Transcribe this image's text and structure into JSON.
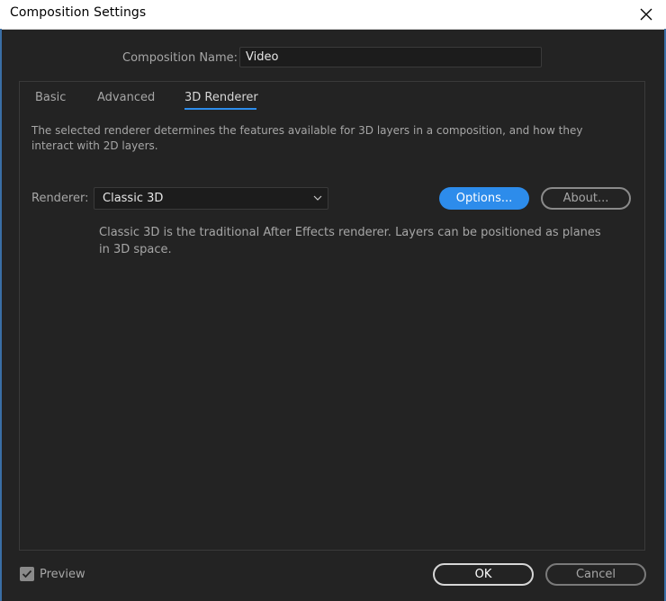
{
  "window": {
    "title": "Composition Settings",
    "close_icon": "close-icon"
  },
  "composition": {
    "name_label": "Composition Name:",
    "name_value": "Video"
  },
  "tabs": [
    {
      "label": "Basic",
      "active": false
    },
    {
      "label": "Advanced",
      "active": false
    },
    {
      "label": "3D Renderer",
      "active": true
    }
  ],
  "renderer_tab": {
    "description": "The selected renderer determines the features available for 3D layers in a composition, and how they interact with 2D layers.",
    "renderer_label": "Renderer:",
    "renderer_value": "Classic 3D",
    "options_button": "Options...",
    "about_button": "About...",
    "renderer_description": "Classic 3D is the traditional After Effects renderer. Layers can be positioned as planes in 3D space."
  },
  "footer": {
    "preview_label": "Preview",
    "preview_checked": true,
    "ok_button": "OK",
    "cancel_button": "Cancel"
  },
  "colors": {
    "background": "#232323",
    "accent": "#2d8ceb",
    "text": "#a6a6a6"
  }
}
